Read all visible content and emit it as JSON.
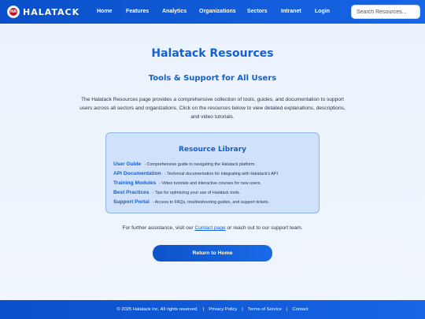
{
  "brand": {
    "name": "HALATACK",
    "logo_text": "HA",
    "logo_icon": "shield-logo"
  },
  "nav": {
    "links": [
      "Home",
      "Features",
      "Analytics",
      "Organizations",
      "Sectors",
      "Intranet",
      "Login"
    ],
    "search_placeholder": "Search Resources..."
  },
  "page": {
    "title": "Halatack Resources",
    "subtitle": "Tools & Support for All Users",
    "intro": "The Halatack Resources page provides a comprehensive collection of tools, guides, and documentation to support users across all sectors and organizations. Click on the resources below to view detailed explanations, descriptions, and video tutorials."
  },
  "library": {
    "title": "Resource Library",
    "items": [
      {
        "label": "User Guide",
        "desc": "- Comprehensive guide to navigating the Halatack platform."
      },
      {
        "label": "API Documentation",
        "desc": "- Technical documentation for integrating with Halatack's API."
      },
      {
        "label": "Training Modules",
        "desc": "- Video tutorials and interactive courses for new users."
      },
      {
        "label": "Best Practices",
        "desc": "- Tips for optimizing your use of Halatack tools."
      },
      {
        "label": "Support Portal",
        "desc": "- Access to FAQs, troubleshooting guides, and support tickets."
      }
    ]
  },
  "assist": {
    "before": "For further assistance, visit our ",
    "link": "Contact page",
    "after": " or reach out to our support team."
  },
  "return_button": "Return to Home",
  "footer": {
    "copyright": "© 2025 Halatack Inc. All rights reserved.",
    "separator": "|",
    "links": [
      "Privacy Policy",
      "Terms of Service",
      "Contact"
    ]
  },
  "colors": {
    "primary": "#1560cf",
    "nav_bg": "#0a4fc9",
    "library_bg": "#cfe1fb",
    "page_bg": "#eaf2fc"
  }
}
